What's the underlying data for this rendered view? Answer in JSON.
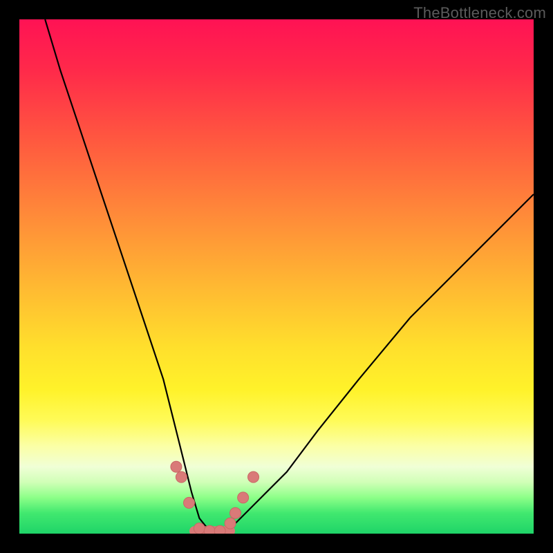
{
  "watermark": "TheBottleneck.com",
  "colors": {
    "frame": "#000000",
    "curve": "#000000",
    "marker": "#d97a78"
  },
  "chart_data": {
    "type": "line",
    "title": "",
    "xlabel": "",
    "ylabel": "",
    "xlim": [
      0,
      100
    ],
    "ylim": [
      0,
      100
    ],
    "grid": false,
    "legend": false,
    "series": [
      {
        "name": "curve",
        "x": [
          5,
          8,
          12,
          16,
          20,
          24,
          28,
          30,
          32,
          33.5,
          35,
          37,
          39,
          42,
          46,
          52,
          58,
          66,
          76,
          88,
          100
        ],
        "y": [
          100,
          90,
          78,
          66,
          54,
          42,
          30,
          22,
          14,
          8,
          3,
          0.5,
          0.5,
          2,
          6,
          12,
          20,
          30,
          42,
          54,
          66
        ]
      }
    ],
    "markers": {
      "name": "near-zero-points",
      "x": [
        30.5,
        31.5,
        33,
        35,
        37,
        39,
        41,
        42,
        43.5,
        45.5
      ],
      "y": [
        13,
        11,
        6,
        1,
        0.5,
        0.5,
        2,
        4,
        7,
        11
      ]
    },
    "flat_segment": {
      "x_start": 34,
      "x_end": 41,
      "y": 0.5
    }
  }
}
